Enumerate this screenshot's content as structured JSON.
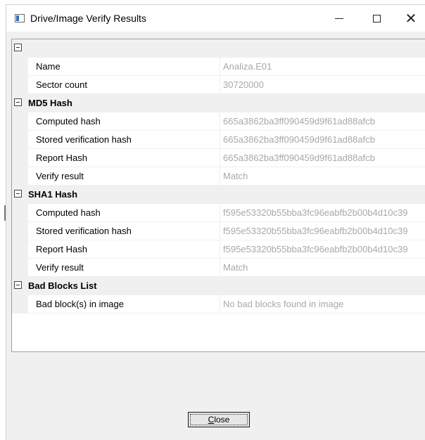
{
  "window": {
    "title": "Drive/Image Verify Results",
    "controls": {
      "minimize": "minimize",
      "maximize": "maximize",
      "close": "close"
    }
  },
  "grid": {
    "top": {
      "label": ""
    },
    "general": [
      {
        "name": "Name",
        "value": "Analiza.E01"
      },
      {
        "name": "Sector count",
        "value": "30720000"
      }
    ],
    "md5": {
      "label": "MD5 Hash",
      "items": [
        {
          "name": "Computed hash",
          "value": "665a3862ba3ff090459d9f61ad88afcb"
        },
        {
          "name": "Stored verification hash",
          "value": "665a3862ba3ff090459d9f61ad88afcb"
        },
        {
          "name": "Report Hash",
          "value": "665a3862ba3ff090459d9f61ad88afcb"
        },
        {
          "name": "Verify result",
          "value": "Match"
        }
      ]
    },
    "sha1": {
      "label": "SHA1 Hash",
      "items": [
        {
          "name": "Computed hash",
          "value": "f595e53320b55bba3fc96eabfb2b00b4d10c39"
        },
        {
          "name": "Stored verification hash",
          "value": "f595e53320b55bba3fc96eabfb2b00b4d10c39"
        },
        {
          "name": "Report Hash",
          "value": "f595e53320b55bba3fc96eabfb2b00b4d10c39"
        },
        {
          "name": "Verify result",
          "value": "Match"
        }
      ]
    },
    "badblocks": {
      "label": "Bad Blocks List",
      "items": [
        {
          "name": "Bad block(s) in image",
          "value": "No bad blocks found in image"
        }
      ]
    }
  },
  "footer": {
    "close_prefix": "C",
    "close_rest": "lose"
  }
}
